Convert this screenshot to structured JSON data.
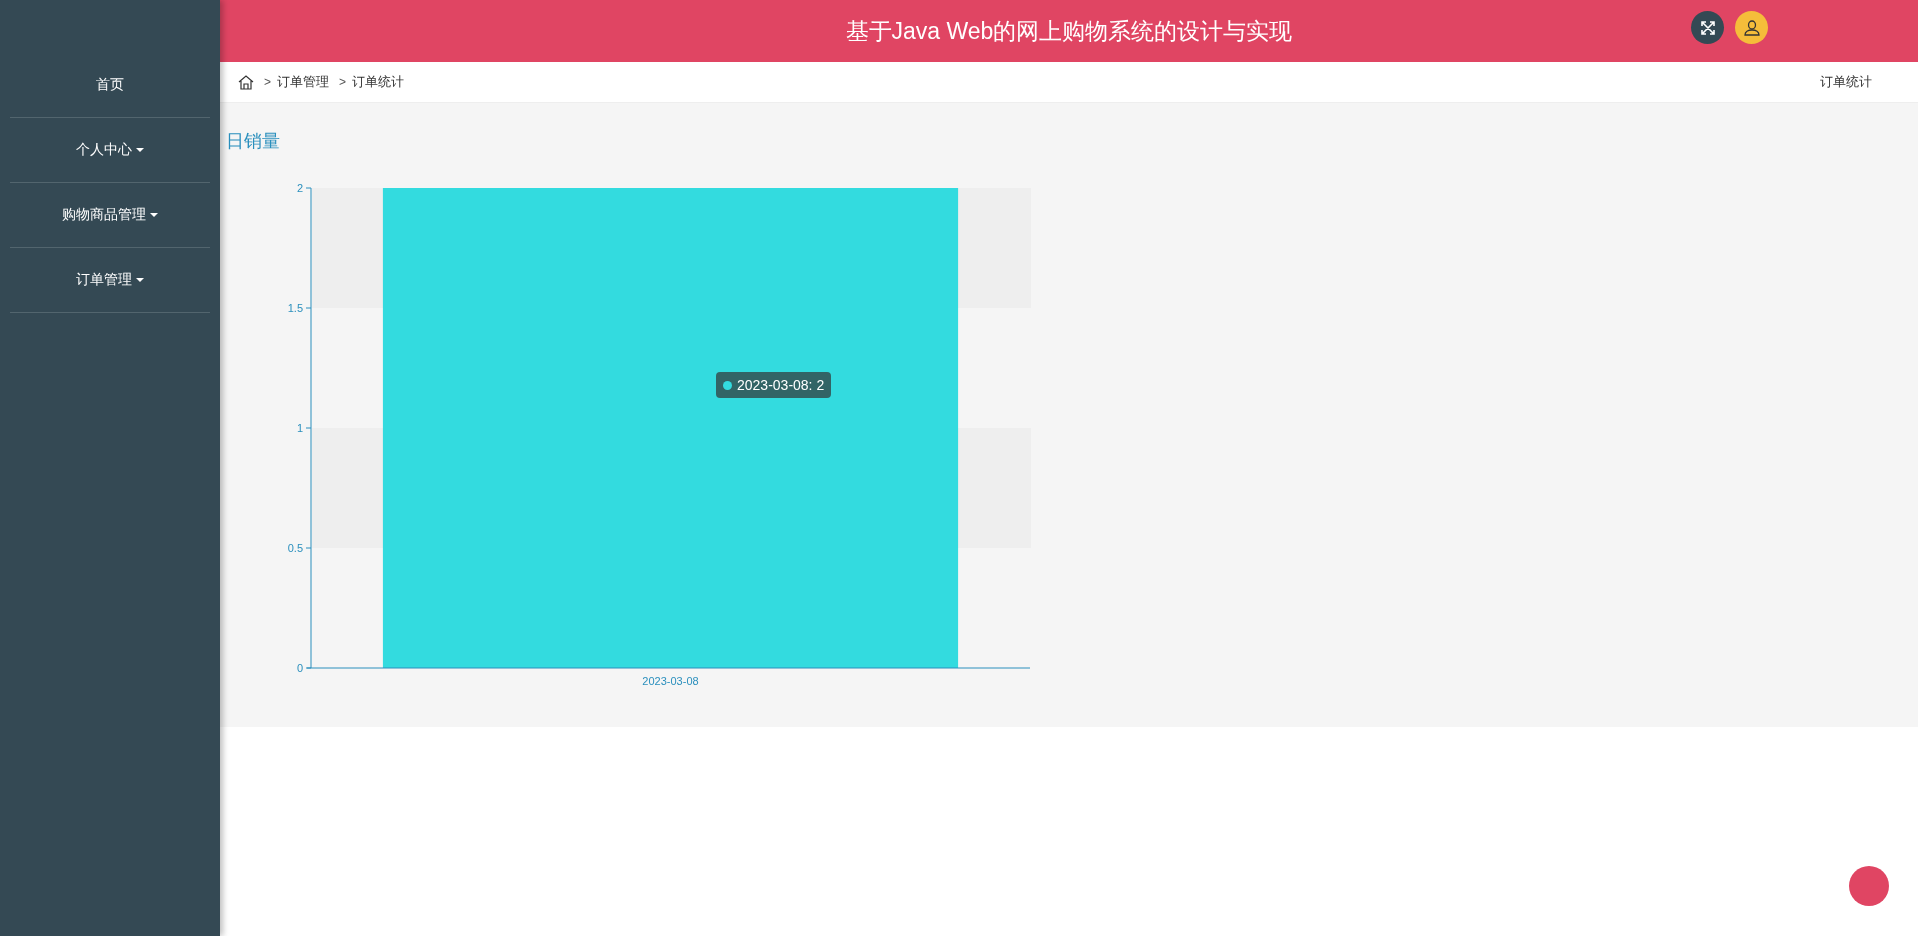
{
  "sidebar": {
    "items": [
      {
        "label": "首页",
        "dropdown": false
      },
      {
        "label": "个人中心",
        "dropdown": true
      },
      {
        "label": "购物商品管理",
        "dropdown": true
      },
      {
        "label": "订单管理",
        "dropdown": true
      }
    ]
  },
  "header": {
    "title": "基于Java Web的网上购物系统的设计与实现"
  },
  "breadcrumb": {
    "separator": ">",
    "items": [
      "订单管理",
      "订单统计"
    ],
    "page_title": "订单统计"
  },
  "panel": {
    "title": "日销量",
    "chart_data": {
      "type": "bar",
      "categories": [
        "2023-03-08"
      ],
      "series": [
        {
          "color": "#33dbdf",
          "values": [
            2
          ]
        }
      ],
      "ylim": [
        0,
        2
      ],
      "yticks": [
        0,
        0.5,
        1,
        1.5,
        2
      ]
    },
    "tooltip": "2023-03-08: 2"
  }
}
